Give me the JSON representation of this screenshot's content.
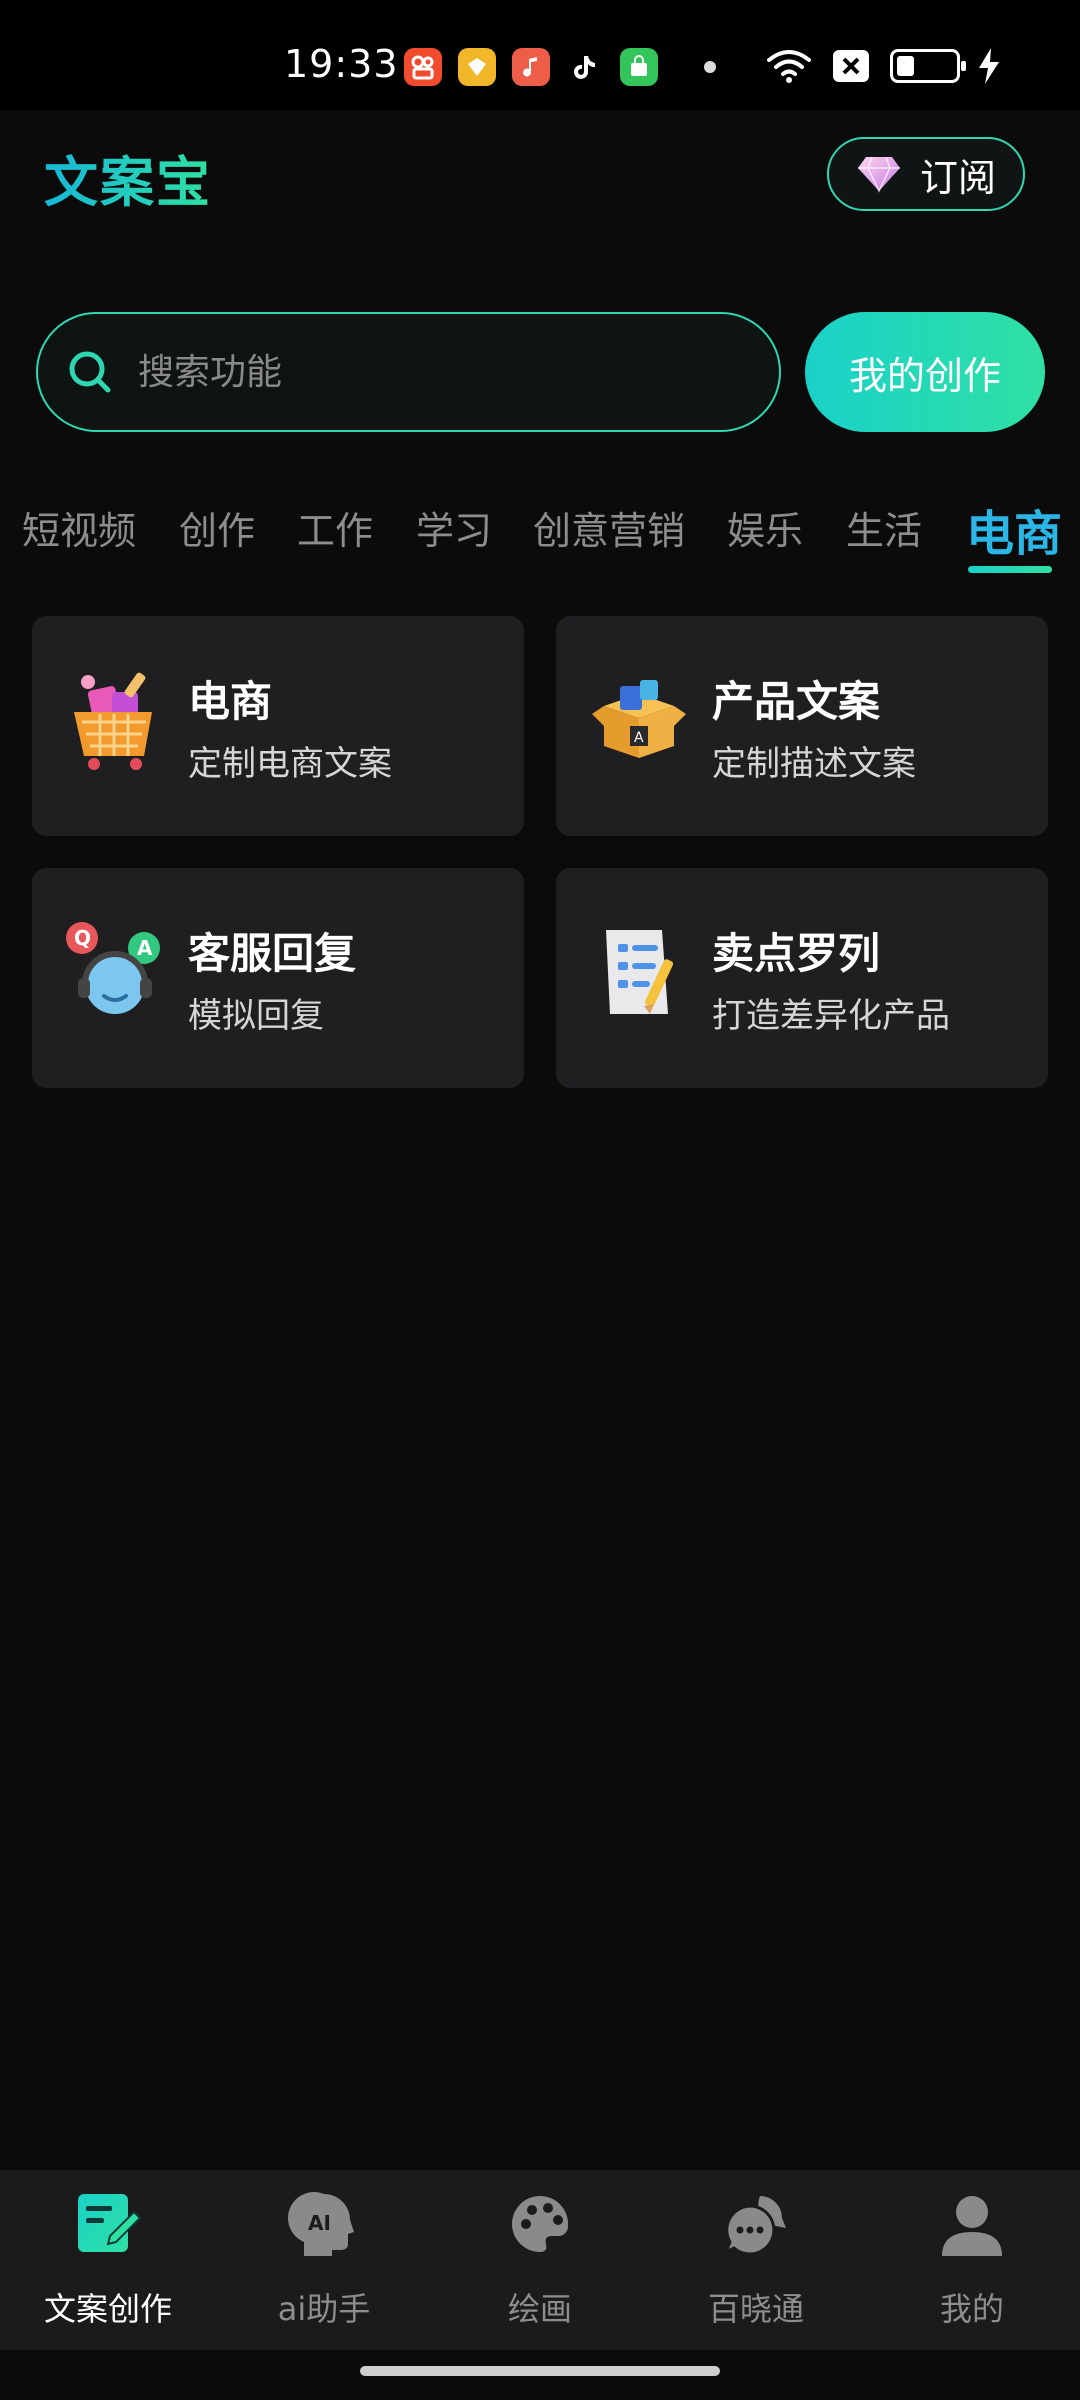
{
  "status_bar": {
    "time": "19:33",
    "notification_icons": [
      "kuaishou-icon",
      "yellow-app-icon",
      "music-icon",
      "tiktok-icon",
      "shopping-icon"
    ],
    "battery_level": 0.3
  },
  "header": {
    "logo": "文案宝",
    "subscribe_label": "订阅"
  },
  "search": {
    "placeholder": "搜索功能",
    "my_creation_label": "我的创作"
  },
  "tabs": [
    {
      "label": "短视频",
      "active": false
    },
    {
      "label": "创作",
      "active": false
    },
    {
      "label": "工作",
      "active": false
    },
    {
      "label": "学习",
      "active": false
    },
    {
      "label": "创意营销",
      "active": false
    },
    {
      "label": "娱乐",
      "active": false
    },
    {
      "label": "生活",
      "active": false
    },
    {
      "label": "电商",
      "active": true
    }
  ],
  "cards": [
    {
      "title": "电商",
      "subtitle": "定制电商文案",
      "icon": "shopping-cart-icon"
    },
    {
      "title": "产品文案",
      "subtitle": "定制描述文案",
      "icon": "product-box-icon"
    },
    {
      "title": "客服回复",
      "subtitle": "模拟回复",
      "icon": "customer-service-icon"
    },
    {
      "title": "卖点罗列",
      "subtitle": "打造差异化产品",
      "icon": "checklist-icon"
    }
  ],
  "bottom_nav": [
    {
      "label": "文案创作",
      "icon": "edit-document-icon",
      "active": true
    },
    {
      "label": "ai助手",
      "icon": "ai-head-icon",
      "active": false
    },
    {
      "label": "绘画",
      "icon": "palette-icon",
      "active": false
    },
    {
      "label": "百晓通",
      "icon": "chat-bubbles-icon",
      "active": false
    },
    {
      "label": "我的",
      "icon": "user-icon",
      "active": false
    }
  ]
}
